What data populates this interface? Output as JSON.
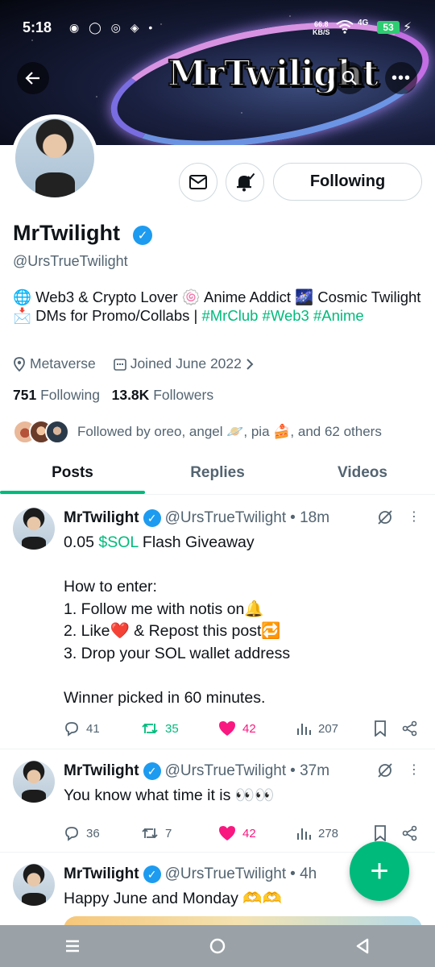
{
  "status_bar": {
    "time": "5:18",
    "notification_icons": "◉ ◯ ◎ ◈ •",
    "net_rate_value": "66.8",
    "net_rate_unit": "KB/S",
    "network": "4G",
    "battery": "53"
  },
  "banner": {
    "title": "MrTwilight"
  },
  "profile": {
    "display_name": "MrTwilight",
    "handle": "@UrsTrueTwilight",
    "bio_text": "🌐 Web3 & Crypto Lover 🍥 Anime Addict 🌌 Cosmic Twilight 📩 DMs for Promo/Collabs | ",
    "bio_tags": [
      "#MrClub",
      "#Web3",
      "#Anime"
    ],
    "location": "Metaverse",
    "joined": "Joined June 2022",
    "following_count": "751",
    "following_label": "Following",
    "followers_count": "13.8K",
    "followers_label": "Followers",
    "followed_by": "Followed by oreo, angel 🪐, pia 🍰, and 62 others",
    "follow_button": "Following"
  },
  "tabs": [
    "Posts",
    "Replies",
    "Videos"
  ],
  "posts": [
    {
      "name": "MrTwilight",
      "handle": "@UrsTrueTwilight",
      "time": "• 18m",
      "body_prefix": "0.05 ",
      "body_cash": "$SOL",
      "body_rest": " Flash Giveaway\n\nHow to enter:\n1. Follow me with notis on🔔\n2. Like❤️ & Repost this post🔁\n3. Drop your SOL wallet address\n\nWinner picked in 60 minutes.",
      "replies": "41",
      "reposts": "35",
      "likes": "42",
      "views": "207"
    },
    {
      "name": "MrTwilight",
      "handle": "@UrsTrueTwilight",
      "time": "• 37m",
      "body": "You know what time it is 👀👀",
      "replies": "36",
      "reposts": "7",
      "likes": "42",
      "views": "278"
    },
    {
      "name": "MrTwilight",
      "handle": "@UrsTrueTwilight",
      "time": "• 4h",
      "body": "Happy June and Monday 🫶🫶"
    }
  ],
  "fab_label": "+",
  "colors": {
    "accent": "#00ba7c",
    "verified": "#1d9bf0",
    "like": "#f91880",
    "muted": "#536471"
  }
}
